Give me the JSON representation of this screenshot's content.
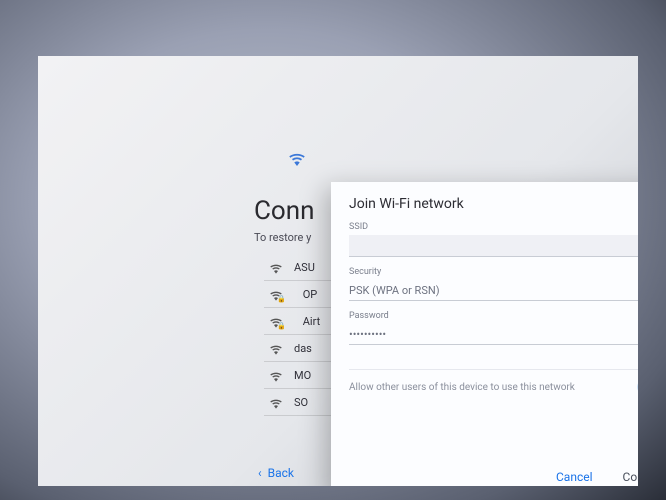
{
  "page": {
    "title": "Conn",
    "subtitle": "To restore y"
  },
  "networks": [
    {
      "label": "ASU",
      "locked": false
    },
    {
      "label": "OP",
      "locked": true
    },
    {
      "label": "Airt",
      "locked": true
    },
    {
      "label": "das",
      "locked": false
    },
    {
      "label": "MO",
      "locked": false
    },
    {
      "label": "SO",
      "locked": false
    }
  ],
  "back": {
    "label": "Back"
  },
  "dialog": {
    "title": "Join Wi-Fi network",
    "ssid_label": "SSID",
    "ssid_value": "",
    "security_label": "Security",
    "security_value": "PSK (WPA or RSN)",
    "password_label": "Password",
    "password_value": "••••••••••",
    "allow_label": "Allow other users of this device to use this network",
    "cancel": "Cancel",
    "connect": "Connect"
  },
  "colors": {
    "accent": "#1a73e8"
  }
}
